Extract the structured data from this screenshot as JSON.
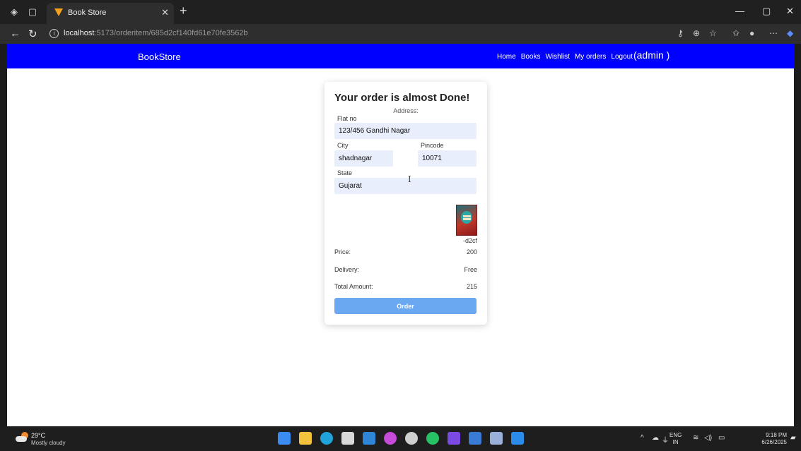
{
  "browser": {
    "tab_title": "Book Store",
    "url_host": "localhost",
    "url_path": ":5173/orderitem/685d2cf140fd61e70fe3562b"
  },
  "navbar": {
    "brand": "BookStore",
    "links": [
      "Home",
      "Books",
      "Wishlist",
      "My orders",
      "Logout"
    ],
    "user": "(admin )"
  },
  "card": {
    "heading": "Your order is almost Done!",
    "address_label": "Address:",
    "flat_label": "Flat no",
    "flat_value": "123/456 Gandhi Nagar",
    "city_label": "City",
    "city_value": "shadnagar",
    "pincode_label": "Pincode",
    "pincode_value": "10071",
    "state_label": "State",
    "state_value": "Gujarat",
    "book_id": "-d2cf",
    "price_label": "Price:",
    "price_value": "200",
    "delivery_label": "Delivery:",
    "delivery_value": "Free",
    "total_label": "Total Amount:",
    "total_value": "215",
    "order_button": "Order"
  },
  "taskbar": {
    "temperature": "29°C",
    "condition": "Mostly cloudy",
    "language_line1": "ENG",
    "language_line2": "IN",
    "time": "9:18 PM",
    "date": "6/26/2025"
  },
  "colors": {
    "navbar": "#0000ff",
    "input_bg": "#e8eefc",
    "order_button": "#6aa8f2"
  }
}
